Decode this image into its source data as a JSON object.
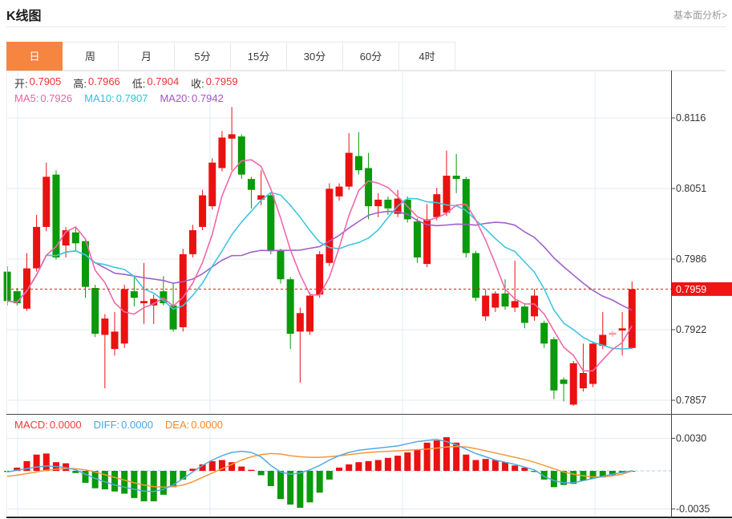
{
  "header": {
    "title": "K线图",
    "link": "基本面分析>"
  },
  "tabs": [
    {
      "label": "日",
      "active": true
    },
    {
      "label": "周",
      "active": false
    },
    {
      "label": "月",
      "active": false
    },
    {
      "label": "5分",
      "active": false
    },
    {
      "label": "15分",
      "active": false
    },
    {
      "label": "30分",
      "active": false
    },
    {
      "label": "60分",
      "active": false
    },
    {
      "label": "4时",
      "active": false
    }
  ],
  "legend": {
    "ohlc": [
      {
        "label": "开:",
        "value": "0.7905",
        "color": "#f23333"
      },
      {
        "label": "高:",
        "value": "0.7966",
        "color": "#f23333"
      },
      {
        "label": "低:",
        "value": "0.7904",
        "color": "#f23333"
      },
      {
        "label": "收:",
        "value": "0.7959",
        "color": "#f23333"
      }
    ],
    "ma": [
      {
        "label": "MA5:",
        "value": "0.7926",
        "color": "#f0609f"
      },
      {
        "label": "MA10:",
        "value": "0.7907",
        "color": "#2cc3dc"
      },
      {
        "label": "MA20:",
        "value": "0.7942",
        "color": "#a453c8"
      }
    ],
    "macd": [
      {
        "label": "MACD:",
        "value": "0.0000",
        "color": "#f23a3a"
      },
      {
        "label": "DIFF:",
        "value": "0.0000",
        "color": "#4aa4e8"
      },
      {
        "label": "DEA:",
        "value": "0.0000",
        "color": "#f5862a"
      }
    ]
  },
  "colors": {
    "up": "#ea1111",
    "up_muted": "#f4a0a0",
    "down": "#0a9a0a",
    "ma5": "#f068a8",
    "ma10": "#3fc6e0",
    "ma20": "#a060c8",
    "diff": "#55aae0",
    "dea": "#f59838",
    "grid": "#e2ebf5",
    "axis": "#444444",
    "zero_line": "#a5d2f0",
    "price_line": "#f01414",
    "tick_text": "#333333",
    "tab_active_bg": "#f5853f"
  },
  "chart_data": {
    "type": "candlestick",
    "title": "K线图",
    "grid": true,
    "y_axis": {
      "side": "right",
      "ticks": [
        {
          "label": "0.8116",
          "value": 0.8116
        },
        {
          "label": "0.8051",
          "value": 0.8051
        },
        {
          "label": "0.7986",
          "value": 0.7986
        },
        {
          "label": "0.7922",
          "value": 0.7922
        },
        {
          "label": "0.7857",
          "value": 0.7857
        }
      ],
      "current_price": {
        "label": "0.7959",
        "value": 0.7959
      }
    },
    "last_bar": {
      "open": 0.7905,
      "high": 0.7966,
      "low": 0.7904,
      "close": 0.7959
    },
    "ma_periods": [
      5,
      10,
      20
    ],
    "candles": [
      [
        0.7975,
        0.798,
        0.7944,
        0.7948
      ],
      [
        0.7957,
        0.796,
        0.7944,
        0.7946
      ],
      [
        0.7941,
        0.7992,
        0.7939,
        0.7978
      ],
      [
        0.7978,
        0.8027,
        0.7975,
        0.8016
      ],
      [
        0.8016,
        0.8075,
        0.8012,
        0.8062
      ],
      [
        0.8064,
        0.8068,
        0.7986,
        0.7988
      ],
      [
        0.7999,
        0.8016,
        0.7988,
        0.8013
      ],
      [
        0.8011,
        0.8016,
        0.7994,
        0.8001
      ],
      [
        0.8003,
        0.8005,
        0.7951,
        0.7961
      ],
      [
        0.796,
        0.7963,
        0.7915,
        0.7918
      ],
      [
        0.7917,
        0.7936,
        0.7868,
        0.7932
      ],
      [
        0.7904,
        0.7938,
        0.7898,
        0.792
      ],
      [
        0.7909,
        0.7963,
        0.7905,
        0.7959
      ],
      [
        0.7957,
        0.797,
        0.7943,
        0.7951
      ],
      [
        0.7946,
        0.7983,
        0.7927,
        0.7948
      ],
      [
        0.7944,
        0.7954,
        0.7927,
        0.795
      ],
      [
        0.7957,
        0.7971,
        0.7944,
        0.7946
      ],
      [
        0.7944,
        0.7964,
        0.792,
        0.7922
      ],
      [
        0.7924,
        0.7996,
        0.792,
        0.7991
      ],
      [
        0.7991,
        0.8018,
        0.7988,
        0.8013
      ],
      [
        0.8016,
        0.805,
        0.8013,
        0.8045
      ],
      [
        0.8035,
        0.8079,
        0.8032,
        0.8075
      ],
      [
        0.807,
        0.8104,
        0.8067,
        0.8098
      ],
      [
        0.8097,
        0.8126,
        0.8068,
        0.8101
      ],
      [
        0.8099,
        0.8101,
        0.806,
        0.8064
      ],
      [
        0.806,
        0.8062,
        0.8033,
        0.805
      ],
      [
        0.8041,
        0.8068,
        0.8036,
        0.8045
      ],
      [
        0.8045,
        0.8047,
        0.7991,
        0.7994
      ],
      [
        0.7994,
        0.7996,
        0.7964,
        0.7968
      ],
      [
        0.7968,
        0.797,
        0.7904,
        0.7918
      ],
      [
        0.792,
        0.7942,
        0.7873,
        0.7937
      ],
      [
        0.792,
        0.7956,
        0.7917,
        0.7953
      ],
      [
        0.7954,
        0.7994,
        0.7951,
        0.7991
      ],
      [
        0.7983,
        0.8056,
        0.798,
        0.8051
      ],
      [
        0.8044,
        0.8056,
        0.804,
        0.8053
      ],
      [
        0.8053,
        0.8102,
        0.805,
        0.8084
      ],
      [
        0.8081,
        0.8103,
        0.8064,
        0.8068
      ],
      [
        0.807,
        0.8084,
        0.8023,
        0.8035
      ],
      [
        0.8035,
        0.8047,
        0.8025,
        0.8041
      ],
      [
        0.8041,
        0.8044,
        0.8027,
        0.8033
      ],
      [
        0.8028,
        0.805,
        0.8025,
        0.8042
      ],
      [
        0.8041,
        0.8044,
        0.802,
        0.8023
      ],
      [
        0.8021,
        0.8024,
        0.7983,
        0.7988
      ],
      [
        0.7982,
        0.8037,
        0.7979,
        0.8023
      ],
      [
        0.8025,
        0.8052,
        0.8022,
        0.8046
      ],
      [
        0.8029,
        0.8086,
        0.8026,
        0.8063
      ],
      [
        0.8063,
        0.8083,
        0.8047,
        0.806
      ],
      [
        0.806,
        0.8062,
        0.7988,
        0.7992
      ],
      [
        0.7992,
        0.7994,
        0.7948,
        0.7951
      ],
      [
        0.7934,
        0.7959,
        0.793,
        0.7953
      ],
      [
        0.7942,
        0.7957,
        0.7938,
        0.7955
      ],
      [
        0.7955,
        0.7968,
        0.794,
        0.7943
      ],
      [
        0.7942,
        0.7985,
        0.7938,
        0.7948
      ],
      [
        0.7943,
        0.7946,
        0.7923,
        0.7928
      ],
      [
        0.7934,
        0.7959,
        0.793,
        0.7953
      ],
      [
        0.7928,
        0.793,
        0.7905,
        0.7909
      ],
      [
        0.7913,
        0.7915,
        0.7858,
        0.7866
      ],
      [
        0.7876,
        0.7878,
        0.7856,
        0.7872
      ],
      [
        0.7853,
        0.7893,
        0.7852,
        0.7891
      ],
      [
        0.7868,
        0.7909,
        0.7865,
        0.7882
      ],
      [
        0.7872,
        0.7911,
        0.7869,
        0.7909
      ],
      [
        0.7907,
        0.7938,
        0.7904,
        0.7917
      ],
      [
        0.7917,
        0.7921,
        0.7915,
        0.7919
      ],
      [
        0.7921,
        0.7938,
        0.7898,
        0.7923
      ],
      [
        0.7905,
        0.7966,
        0.7904,
        0.7959
      ]
    ],
    "muted_candles": [
      62
    ],
    "macd": {
      "unit": 0.0001,
      "y_ticks": [
        {
          "label": "0.0030",
          "value": 0.003
        },
        {
          "label": "-0.0035",
          "value": -0.0035
        }
      ],
      "hist": [
        -1,
        3,
        9,
        15,
        16,
        8,
        7,
        -2,
        -11,
        -16,
        -17,
        -19,
        -21,
        -25,
        -28,
        -28,
        -22,
        -15,
        -8,
        2,
        6,
        9,
        10,
        8,
        4,
        1,
        -4,
        -14,
        -26,
        -31,
        -34,
        -29,
        -20,
        -8,
        3,
        6,
        8,
        9,
        10,
        12,
        14,
        17,
        20,
        26,
        28,
        31,
        26,
        15,
        10,
        11,
        10,
        8,
        5,
        3,
        -1,
        -8,
        -15,
        -13,
        -12,
        -9,
        -7,
        -6,
        -4,
        -2,
        -0.5
      ],
      "diff": [
        -1,
        0.5,
        2,
        3.5,
        4.5,
        4,
        3,
        1,
        -3,
        -7,
        -10,
        -13,
        -15,
        -17,
        -18.5,
        -19,
        -17,
        -13,
        -7,
        -1,
        5,
        10,
        14,
        17,
        18,
        17,
        13,
        5,
        -1,
        -3,
        -2,
        1,
        5,
        10,
        14,
        17,
        19,
        20,
        21,
        22,
        23,
        25,
        27,
        28,
        29,
        27,
        24,
        20,
        16,
        13,
        10,
        8,
        6,
        3.5,
        1,
        -5,
        -9,
        -11,
        -11,
        -9,
        -7,
        -5,
        -3,
        -1.5,
        0
      ],
      "dea": [
        -5,
        -4,
        -2.5,
        -1,
        0.5,
        1.5,
        2.2,
        2,
        1,
        -1,
        -3.5,
        -6,
        -8.5,
        -11,
        -13,
        -14.5,
        -15,
        -14.5,
        -13,
        -10,
        -6,
        -2,
        2,
        6,
        10,
        13,
        15,
        16,
        15.5,
        14,
        13,
        12.5,
        12.5,
        13,
        14,
        15,
        16,
        17,
        17.5,
        18,
        18.5,
        19,
        19.5,
        20,
        21,
        22,
        22.5,
        22,
        20.5,
        18.5,
        16.5,
        14.5,
        12.5,
        10.5,
        8,
        5,
        2,
        -1,
        -3,
        -4.5,
        -5.5,
        -5.5,
        -4.5,
        -3,
        0
      ]
    }
  }
}
